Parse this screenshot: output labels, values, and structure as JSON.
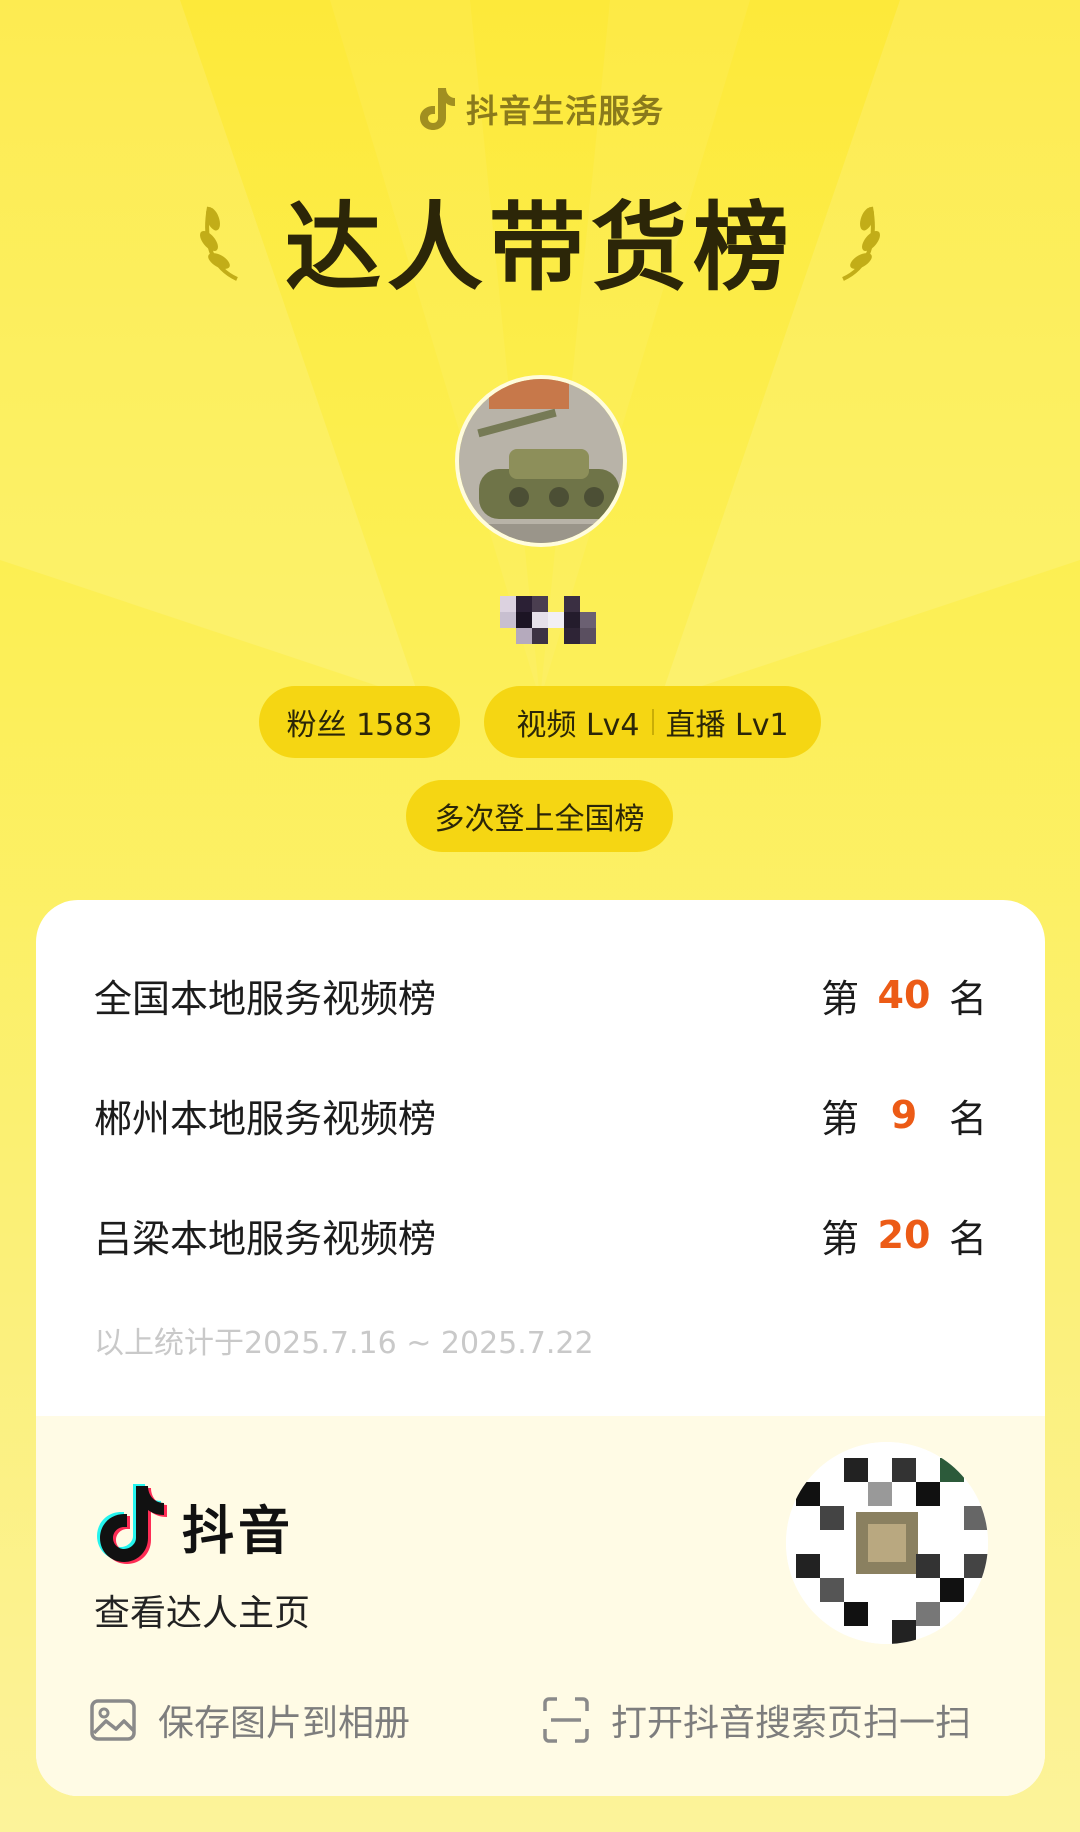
{
  "header": {
    "brand_text": "抖音生活服务",
    "title": "达人带货榜"
  },
  "profile": {
    "avatar": "tank-model-avatar",
    "nickname_pixelated": true,
    "pills": {
      "fans": "粉丝 1583",
      "video_level": "视频 Lv4",
      "live_level": "直播 Lv1",
      "national": "多次登上全国榜"
    }
  },
  "ranks": [
    {
      "name": "全国本地服务视频榜",
      "prefix": "第",
      "number": "40",
      "suffix": "名"
    },
    {
      "name": "郴州本地服务视频榜",
      "prefix": "第",
      "number": "9",
      "suffix": "名"
    },
    {
      "name": "吕梁本地服务视频榜",
      "prefix": "第",
      "number": "20",
      "suffix": "名"
    }
  ],
  "stat_note": "以上统计于2025.7.16 ~ 2025.7.22",
  "footer": {
    "app_name": "抖音",
    "view_home": "查看达人主页",
    "save_label": "保存图片到相册",
    "scan_label": "打开抖音搜索页扫一扫"
  },
  "colors": {
    "accent": "#ec5b16",
    "pill": "#f5d613",
    "background": "#fcef52"
  }
}
